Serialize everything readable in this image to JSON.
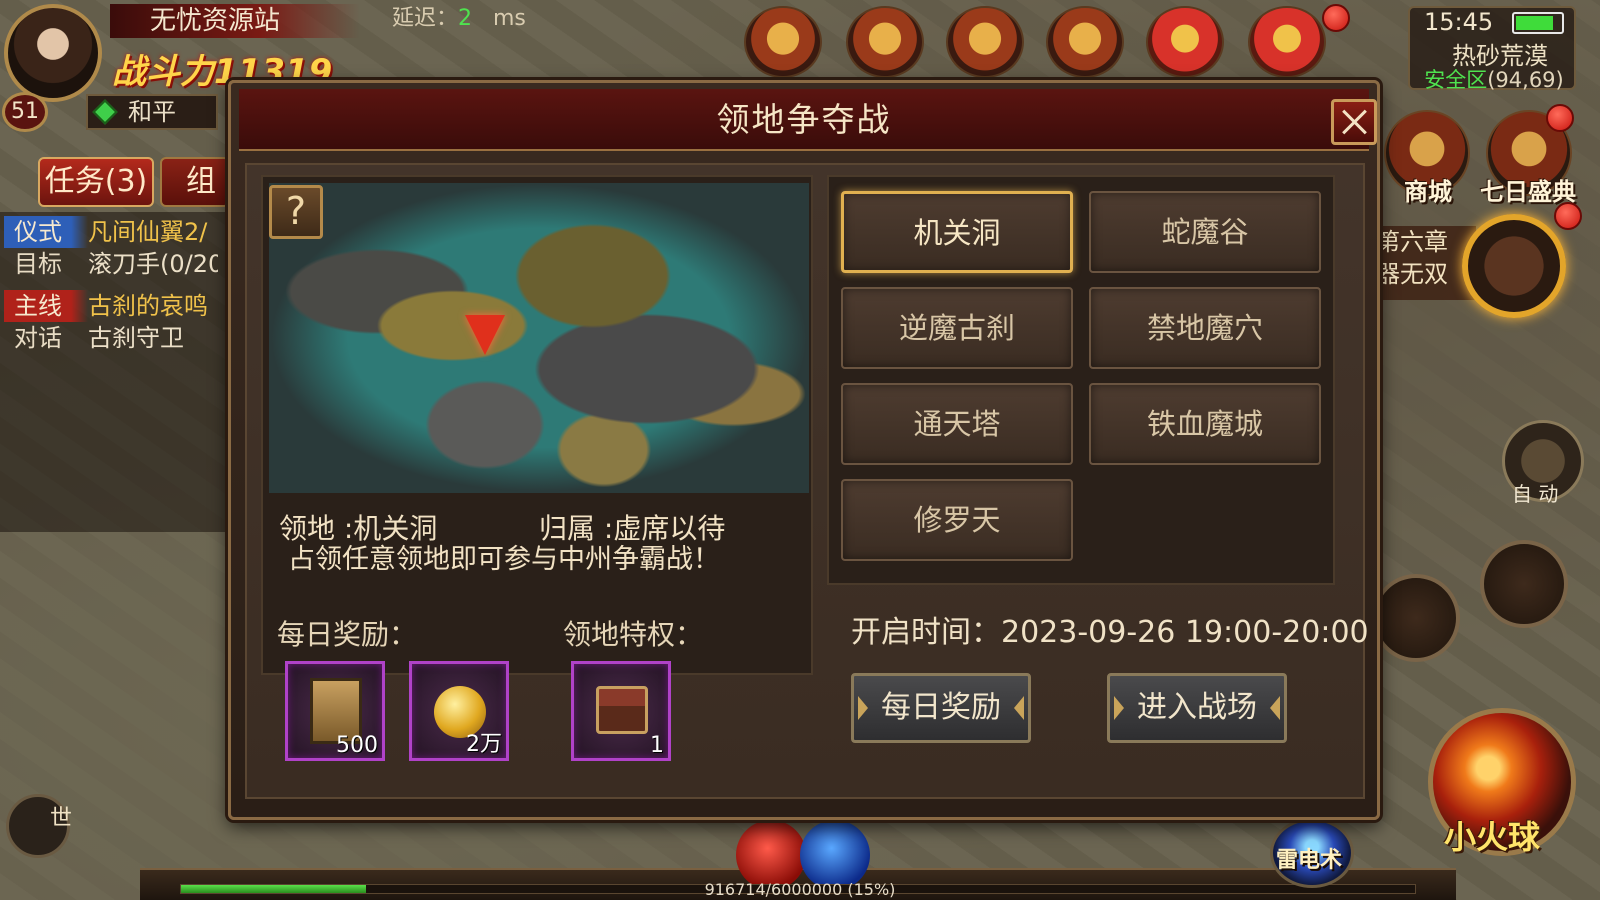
{
  "player": {
    "site_name": "无忧资源站",
    "power_text": "战斗力11319",
    "level": "51",
    "pk_mode": "和平",
    "latency_label": "延迟：",
    "latency_value": "2",
    "latency_unit": "ms"
  },
  "quest": {
    "tab_label": "任务(3)",
    "group_tab_label": "组队",
    "rows": [
      {
        "tag": "仪式",
        "text": "凡间仙翼2/"
      },
      {
        "tag": "目标",
        "text": "滚刀手(0/20"
      },
      {
        "tag": "主线",
        "text": "古刹的哀鸣"
      },
      {
        "tag": "对话",
        "text": "古刹守卫"
      }
    ]
  },
  "status": {
    "time": "15:45",
    "battery_level": 0.85,
    "zone": "热砂荒漠",
    "safety": "安全区",
    "coords": "(94,69)"
  },
  "side": {
    "shop_label": "商城",
    "seven_day_label": "七日盛典",
    "chapter_line1": "第六章",
    "chapter_line2": "器无双",
    "auto_label": "自 动"
  },
  "skills": {
    "fireball_label": "小火球",
    "thunder_label": "雷电术"
  },
  "chat": {
    "world_label": "世"
  },
  "exp": {
    "text": "916714/6000000 (15%)",
    "fraction": 0.15
  },
  "dialog": {
    "title": "领地争夺战",
    "territory_label": "领地 :",
    "territory_value": "机关洞",
    "owner_label": "归属 :",
    "owner_value": "虚席以待",
    "note": "占领任意领地即可参与中州争霸战！",
    "help_symbol": "?",
    "zones": [
      "机关洞",
      "蛇魔谷",
      "逆魔古刹",
      "禁地魔穴",
      "通天塔",
      "铁血魔城",
      "修罗天"
    ],
    "selected_zone": "机关洞",
    "daily_reward_label": "每日奖励：",
    "privilege_label": "领地特权：",
    "open_time_label": "开启时间：",
    "open_time_value": "2023-09-26 19:00-20:00",
    "rewards": [
      {
        "icon": "scroll-icon",
        "count": "500"
      },
      {
        "icon": "gold-coins-icon",
        "count": "2万"
      }
    ],
    "privileges": [
      {
        "icon": "treasure-chest-icon",
        "count": "1"
      }
    ],
    "daily_reward_button": "每日奖励",
    "enter_button": "进入战场"
  }
}
